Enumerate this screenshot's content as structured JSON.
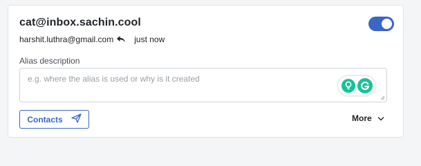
{
  "alias": {
    "email": "cat@inbox.sachin.cool",
    "enabled": true,
    "mailbox": "harshit.luthra@gmail.com",
    "last_activity": "just now"
  },
  "description": {
    "label": "Alias description",
    "placeholder": "e.g. where the alias is used or why is it created",
    "value": ""
  },
  "actions": {
    "contacts_label": "Contacts",
    "more_label": "More"
  },
  "icons": {
    "reply": "reply-icon",
    "send": "send-icon",
    "chevron": "chevron-down-icon",
    "grammarly_bulb": "lightbulb-icon",
    "grammarly_logo": "grammarly-icon"
  },
  "colors": {
    "accent": "#3a67c4",
    "grammarly": "#15c39a"
  }
}
